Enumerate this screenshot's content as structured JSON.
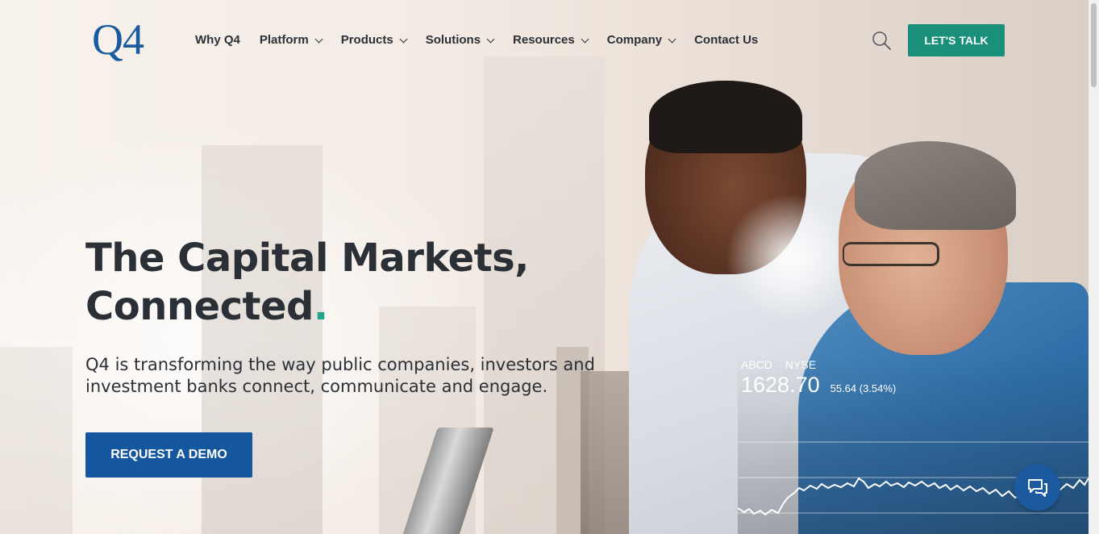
{
  "header": {
    "logo": "Q4",
    "nav": [
      {
        "label": "Why Q4",
        "has_dropdown": false
      },
      {
        "label": "Platform",
        "has_dropdown": true
      },
      {
        "label": "Products",
        "has_dropdown": true
      },
      {
        "label": "Solutions",
        "has_dropdown": true
      },
      {
        "label": "Resources",
        "has_dropdown": true
      },
      {
        "label": "Company",
        "has_dropdown": true
      },
      {
        "label": "Contact Us",
        "has_dropdown": false
      }
    ],
    "search_icon": "search-icon",
    "cta_label": "LET'S TALK"
  },
  "hero": {
    "title_line1": "The Capital Markets,",
    "title_line2": "Connected",
    "title_accent": ".",
    "subtitle": "Q4 is transforming the way public companies, investors and investment banks connect, communicate and engage.",
    "cta_label": "REQUEST A DEMO"
  },
  "ticker": {
    "symbol": "ABCD",
    "exchange": "NYSE",
    "price": "1628.70",
    "change": "55.64 (3.54%)"
  },
  "chat": {
    "icon": "chat-icon"
  },
  "colors": {
    "brand_blue": "#14579e",
    "accent_green": "#1a8f7a",
    "logo_blue": "#1a5a9e",
    "text_dark": "#2b2f36"
  }
}
